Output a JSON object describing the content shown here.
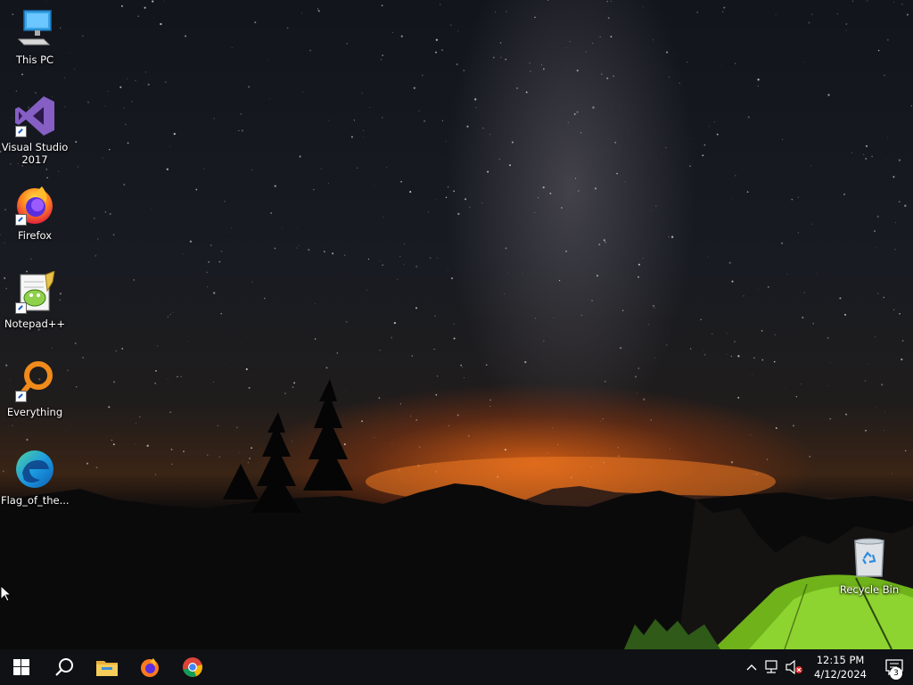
{
  "desktop": {
    "icons": [
      {
        "label": "This PC"
      },
      {
        "label": "Visual Studio 2017"
      },
      {
        "label": "Firefox"
      },
      {
        "label": "Notepad++"
      },
      {
        "label": "Everything"
      },
      {
        "label": "Flag_of_the..."
      },
      {
        "label": "Recycle Bin"
      }
    ]
  },
  "taskbar": {
    "pinned": [
      "start-windows-icon",
      "search-icon",
      "file-explorer-icon",
      "firefox-icon",
      "chrome-icon"
    ],
    "tray": {
      "time": "12:15 PM",
      "date": "4/12/2024",
      "notification_count": "3"
    }
  },
  "colors": {
    "taskbar": "#101114",
    "accent_orange": "#e8681a",
    "tent_green": "#7ed321"
  }
}
